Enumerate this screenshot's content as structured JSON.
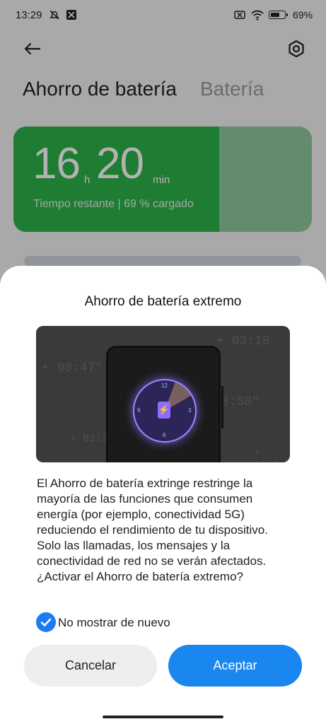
{
  "status": {
    "time": "13:29",
    "battery_pct": "69",
    "battery_level": 0.69,
    "icons": [
      "mute-alarm-icon",
      "app-notification-icon",
      "sim-off-icon",
      "wifi-icon",
      "battery-icon"
    ]
  },
  "header": {
    "tabs": [
      {
        "label": "Ahorro de batería",
        "active": true
      },
      {
        "label": "Batería",
        "active": false
      }
    ],
    "back_icon": "back-arrow-icon",
    "settings_icon": "gear-icon"
  },
  "battery_card": {
    "hours": "16",
    "hours_unit": "h",
    "minutes": "20",
    "minutes_unit": "min",
    "remaining_text": "Tiempo restante | 69 % cargado",
    "charge_fraction": 0.69,
    "color_charged": "#2db34a",
    "color_empty": "#8fc79c"
  },
  "dialog": {
    "title": "Ahorro de batería extremo",
    "illustration": {
      "ghost_times": [
        "+ 03:18",
        "+ 00:47\"",
        "3:50\"",
        "+ 01:2",
        "+ 01:2"
      ],
      "dial_numbers": [
        "12",
        "3",
        "6",
        "9"
      ]
    },
    "body": "El Ahorro de batería extringe restringe la mayoría de las funciones que consumen energía (por ejemplo, conectividad 5G) reduciendo el rendimiento de tu dispositivo. Solo las llamadas, los mensajes y la conectividad de red no se verán afectados. ¿Activar el Ahorro de batería extremo?",
    "checkbox_label": "No mostrar de nuevo",
    "checkbox_checked": true,
    "cancel_label": "Cancelar",
    "accept_label": "Aceptar",
    "accent_color": "#1a86f0"
  }
}
